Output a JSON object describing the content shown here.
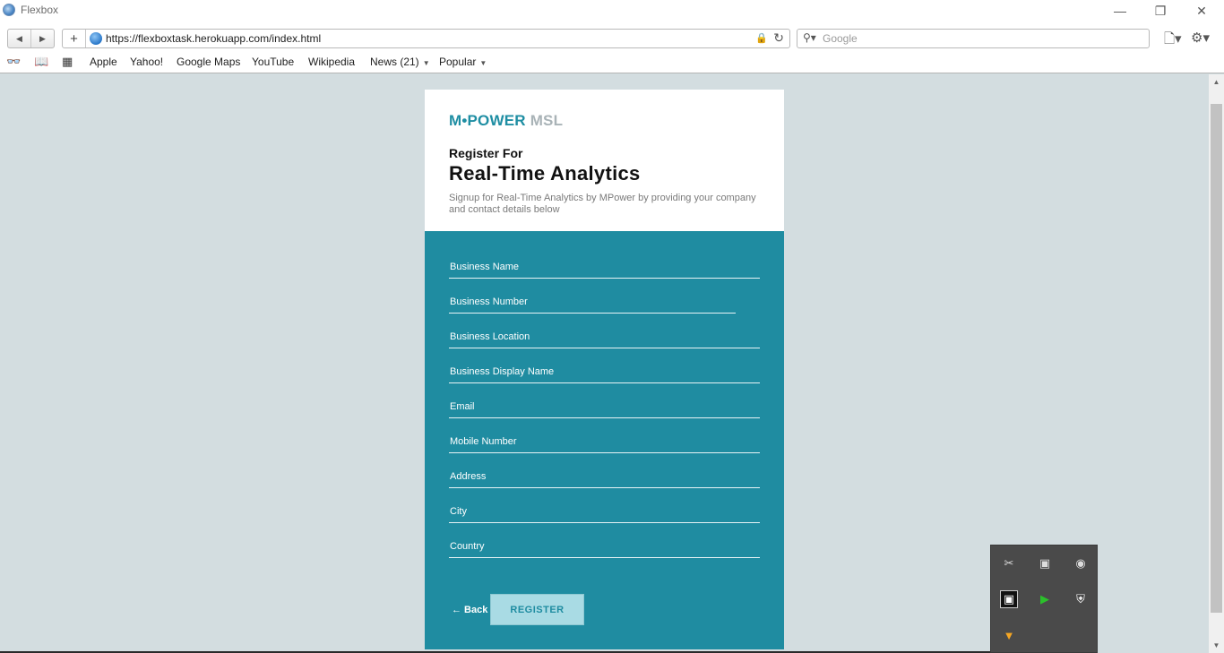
{
  "window": {
    "title": "Flexbox",
    "icon": "browser-globe-icon"
  },
  "toolbar": {
    "url": "https://flexboxtask.herokuapp.com/index.html",
    "search_placeholder": "Google"
  },
  "bookmarks": [
    {
      "label": "Apple"
    },
    {
      "label": "Yahoo!"
    },
    {
      "label": "Google Maps"
    },
    {
      "label": "YouTube"
    },
    {
      "label": "Wikipedia"
    },
    {
      "label": "News (21)",
      "dropdown": true
    },
    {
      "label": "Popular",
      "dropdown": true
    }
  ],
  "page": {
    "logo": {
      "part1": "M•POWER",
      "part2": "MSL"
    },
    "register_for": "Register For",
    "headline": "Real-Time Analytics",
    "subtitle": "Signup for Real-Time Analytics by MPower by providing your company and contact details below",
    "fields": [
      "Business Name",
      "Business Number",
      "Business Location",
      "Business Display Name",
      "Email",
      "Mobile Number",
      "Address",
      "City",
      "Country"
    ],
    "back_label": "← Back",
    "register_label": "REGISTER"
  },
  "colors": {
    "accent": "#1f8ca1",
    "page_background": "#d3dde0",
    "register_button": "#a9dbe4"
  },
  "tray_icons": [
    "snip-icon",
    "monitor-icon",
    "camera-icon",
    "media-icon",
    "play-icon",
    "shield-alert-icon",
    "filter-icon"
  ]
}
